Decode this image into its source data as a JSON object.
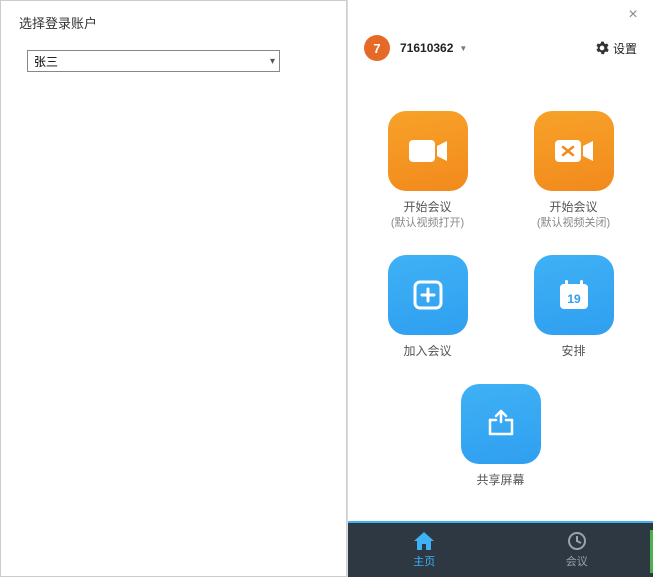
{
  "left": {
    "title": "选择登录账户",
    "selected_account": "张三"
  },
  "header": {
    "avatar_letter": "7",
    "user_id": "71610362",
    "settings_label": "设置"
  },
  "tiles": {
    "start_video_on": {
      "label1": "开始会议",
      "label2": "(默认视频打开)"
    },
    "start_video_off": {
      "label1": "开始会议",
      "label2": "(默认视频关闭)"
    },
    "join": {
      "label1": "加入会议"
    },
    "schedule": {
      "label1": "安排",
      "calendar_day": "19"
    },
    "share": {
      "label1": "共享屏幕"
    }
  },
  "nav": {
    "home": "主页",
    "meetings": "会议"
  }
}
